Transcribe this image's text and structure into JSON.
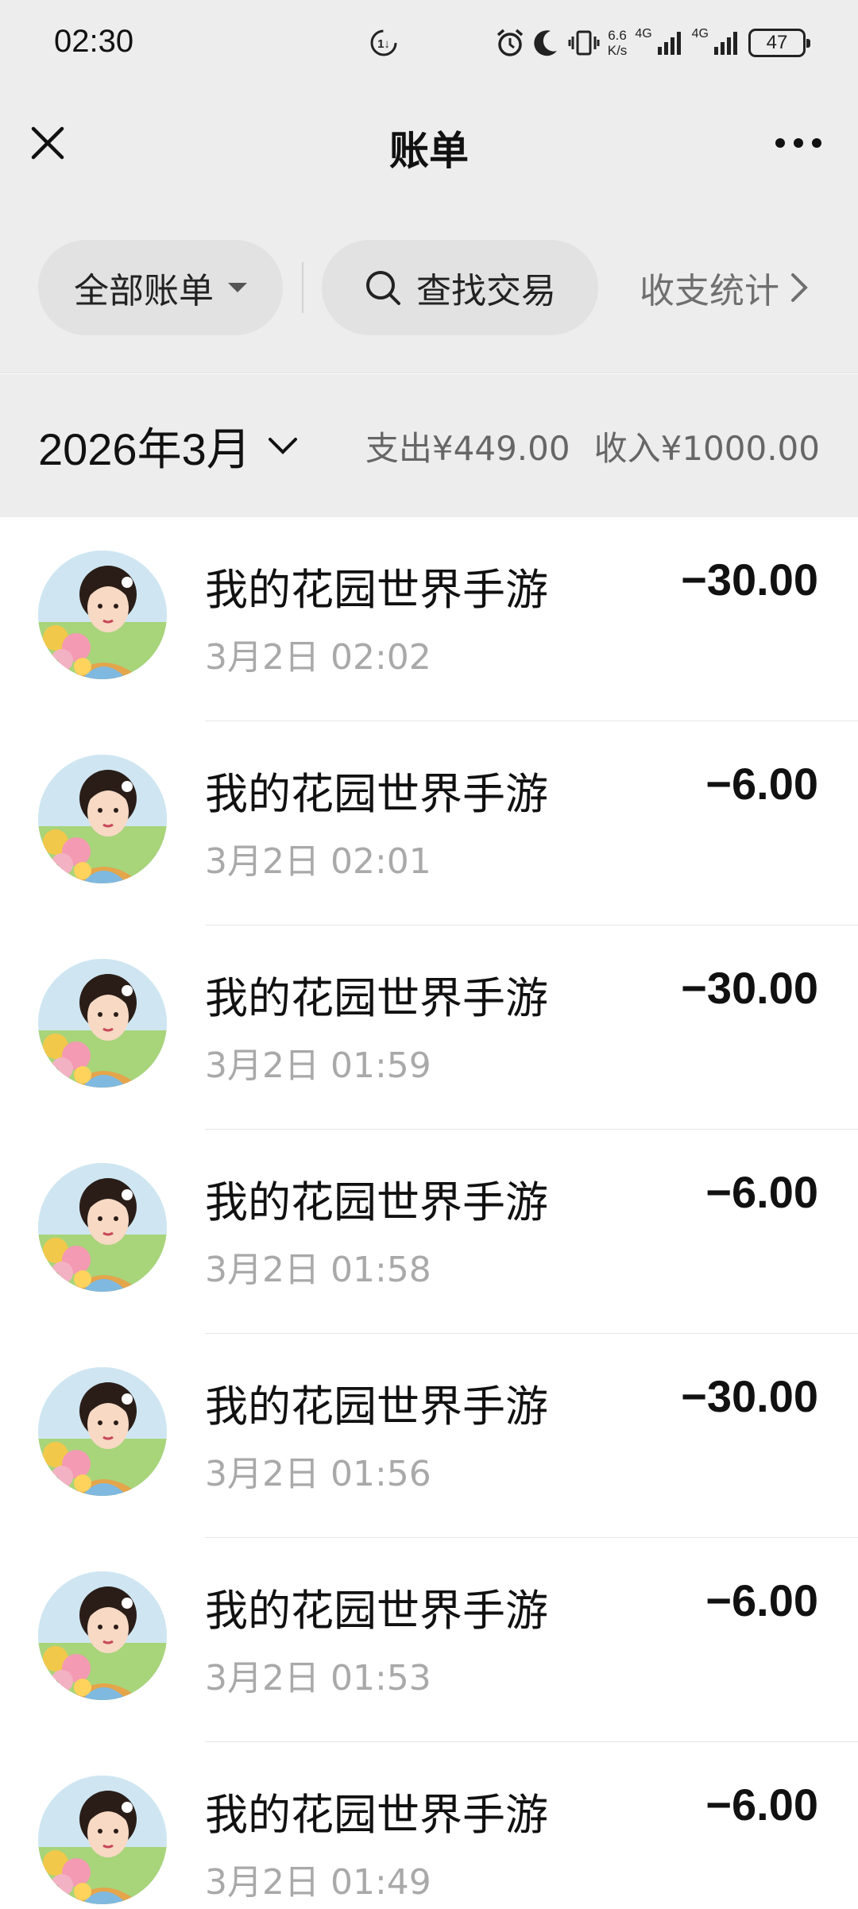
{
  "status_bar": {
    "time": "02:30",
    "net_speed_value": "6.6",
    "net_speed_unit": "K/s",
    "sim1_label": "4G",
    "sim2_label": "4G",
    "battery": "47",
    "icons": [
      "data-saver-icon",
      "alarm-icon",
      "moon-icon",
      "vibrate-icon",
      "signal-icon",
      "signal-icon",
      "battery-icon"
    ]
  },
  "header": {
    "title": "账单",
    "close_icon": "close-icon",
    "more_icon": "more-icon"
  },
  "filters": {
    "all_bills_label": "全部账单",
    "search_label": "查找交易",
    "stats_label": "收支统计"
  },
  "month_bar": {
    "month_label": "2026年3月",
    "expense_label": "支出¥449.00",
    "income_label": "收入¥1000.00"
  },
  "transactions": [
    {
      "name": "我的花园世界手游",
      "time": "3月2日 02:02",
      "amount": "−30.00"
    },
    {
      "name": "我的花园世界手游",
      "time": "3月2日 02:01",
      "amount": "−6.00"
    },
    {
      "name": "我的花园世界手游",
      "time": "3月2日 01:59",
      "amount": "−30.00"
    },
    {
      "name": "我的花园世界手游",
      "time": "3月2日 01:58",
      "amount": "−6.00"
    },
    {
      "name": "我的花园世界手游",
      "time": "3月2日 01:56",
      "amount": "−30.00"
    },
    {
      "name": "我的花园世界手游",
      "time": "3月2日 01:53",
      "amount": "−6.00"
    },
    {
      "name": "我的花园世界手游",
      "time": "3月2日 01:49",
      "amount": "−6.00"
    }
  ],
  "colors": {
    "header_bg": "#ededed",
    "pill_bg": "#e2e2e2",
    "muted_text": "#a9a9a9"
  }
}
